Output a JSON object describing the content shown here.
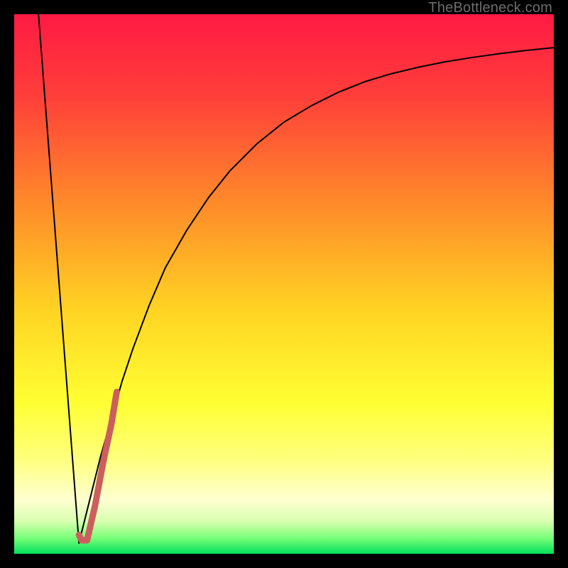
{
  "watermark": "TheBottleneck.com",
  "chart_data": {
    "type": "line",
    "title": "",
    "xlabel": "",
    "ylabel": "",
    "xlim": [
      0,
      100
    ],
    "ylim": [
      0,
      100
    ],
    "gradient_stops": [
      {
        "pos": 0.0,
        "color": "#ff1a44"
      },
      {
        "pos": 0.15,
        "color": "#ff3e3a"
      },
      {
        "pos": 0.35,
        "color": "#ff8a2a"
      },
      {
        "pos": 0.55,
        "color": "#ffd423"
      },
      {
        "pos": 0.72,
        "color": "#ffff33"
      },
      {
        "pos": 0.82,
        "color": "#ffff7a"
      },
      {
        "pos": 0.9,
        "color": "#ffffd0"
      },
      {
        "pos": 0.94,
        "color": "#d8ffb0"
      },
      {
        "pos": 0.97,
        "color": "#7cff7a"
      },
      {
        "pos": 1.0,
        "color": "#00e05a"
      }
    ],
    "series": [
      {
        "name": "left-descent",
        "color": "#000000",
        "width": 2,
        "x": [
          4.5,
          12.0
        ],
        "values": [
          100,
          2
        ]
      },
      {
        "name": "right-curve",
        "color": "#000000",
        "width": 2,
        "x": [
          12,
          14,
          16,
          18,
          20,
          22,
          25,
          28,
          32,
          36,
          40,
          45,
          50,
          55,
          60,
          65,
          70,
          75,
          80,
          85,
          90,
          95,
          100
        ],
        "values": [
          2,
          10,
          18,
          25,
          32,
          38,
          46,
          53,
          60,
          66,
          71,
          76,
          80,
          83,
          85.5,
          87.5,
          89,
          90.2,
          91.2,
          92,
          92.7,
          93.3,
          93.8
        ]
      },
      {
        "name": "highlight-hook",
        "color": "#cc5e5e",
        "width": 9,
        "x": [
          12.0,
          12.5,
          13.5,
          15.0,
          16.5,
          18.0,
          19.0
        ],
        "values": [
          3.5,
          2.5,
          2.5,
          9,
          17,
          24,
          30
        ]
      }
    ]
  }
}
